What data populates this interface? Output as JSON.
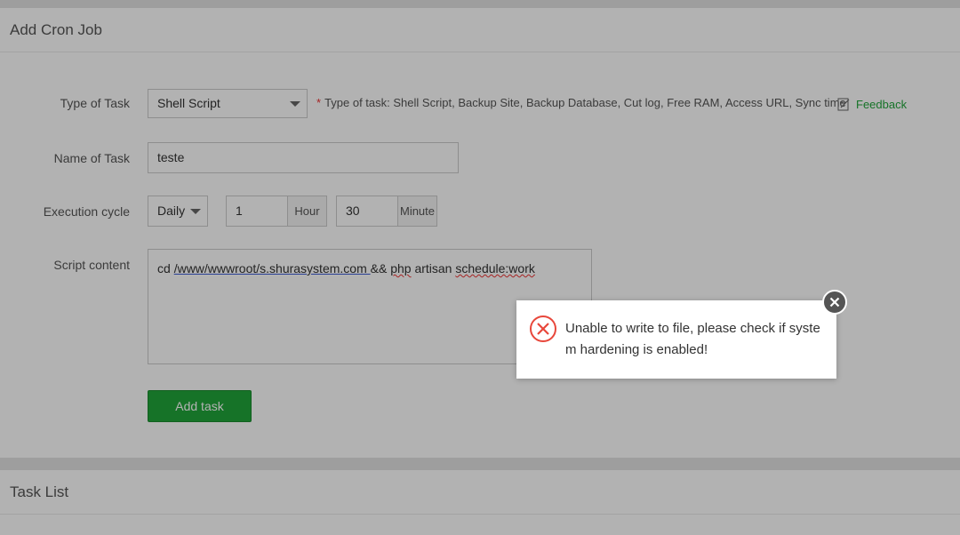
{
  "add_panel": {
    "title": "Add Cron Job",
    "type_label": "Type of Task",
    "type_value": "Shell Script",
    "type_hint": "Type of task: Shell Script, Backup Site, Backup Database, Cut log, Free RAM, Access URL, Sync time",
    "feedback_label": "Feedback",
    "name_label": "Name of Task",
    "name_value": "teste",
    "cycle_label": "Execution cycle",
    "cycle_value": "Daily",
    "hour_value": "1",
    "hour_unit": "Hour",
    "minute_value": "30",
    "minute_unit": "Minute",
    "script_label": "Script content",
    "script_parts": {
      "p1": "cd ",
      "p2": "/www/wwwroot/s.shurasystem.com ",
      "p3": " && ",
      "p4": "php",
      "p5": " artisan ",
      "p6": "schedule:work"
    },
    "add_button": "Add task"
  },
  "list_panel": {
    "title": "Task List"
  },
  "toast": {
    "message": "Unable to write to file, please check if system hardening is enabled!",
    "error_color": "#e8473b"
  }
}
